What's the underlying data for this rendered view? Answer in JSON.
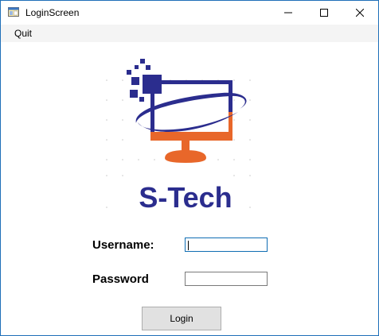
{
  "window": {
    "title": "LoginScreen",
    "border_color": "#1f6fb8"
  },
  "menu": {
    "quit_label": "Quit"
  },
  "logo": {
    "brand_text": "S-Tech",
    "colors": {
      "navy": "#2b2d8e",
      "orange": "#e8672a"
    }
  },
  "form": {
    "username_label": "Username:",
    "username_value": "",
    "password_label": "Password",
    "password_value": "",
    "login_label": "Login"
  }
}
